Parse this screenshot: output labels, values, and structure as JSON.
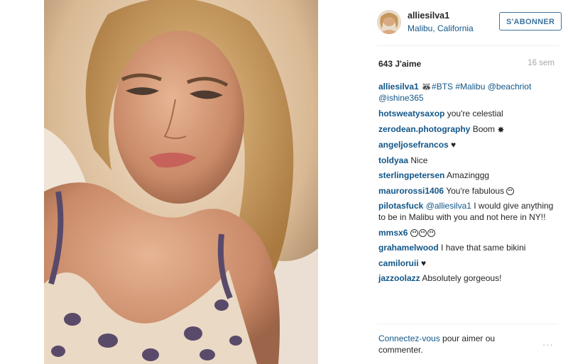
{
  "post": {
    "username": "alliesilva1",
    "location": "Malibu, California",
    "follow_label": "S'ABONNER",
    "likes": "643 J'aime",
    "time_ago": "16 sem"
  },
  "caption": {
    "user": "alliesilva1",
    "emoji": "🦝",
    "parts": [
      "#BTS",
      "#Malibu",
      "@beachriot",
      "@ishine365"
    ]
  },
  "comments": [
    {
      "user": "hotsweatysaxop",
      "text": "you're celestial"
    },
    {
      "user": "zerodean.photography",
      "text": "Boom",
      "emoji": "burst-icon"
    },
    {
      "user": "angeljosefrancos",
      "text": "♥"
    },
    {
      "user": "toldyaa",
      "text": "Nice"
    },
    {
      "user": "sterlingpetersen",
      "text": "Amazinggg"
    },
    {
      "user": "maurorossi1406",
      "text": "You're fabulous",
      "emoji": "smiley-icon"
    },
    {
      "user": "pilotasfuck",
      "mention": "@alliesilva1",
      "text": "I would give anything to be in Malibu with you and not here in NY!!"
    },
    {
      "user": "mmsx6",
      "text": "",
      "emoji": "smiley-icon x3"
    },
    {
      "user": "grahamelwood",
      "text": "I have that same bikini"
    },
    {
      "user": "camiloruii",
      "text": "♥"
    },
    {
      "user": "jazzoolazz",
      "text": "Absolutely gorgeous!"
    }
  ],
  "footer": {
    "login_link": "Connectez-vous",
    "rest": " pour aimer ou commenter.",
    "more_icon": "···"
  }
}
